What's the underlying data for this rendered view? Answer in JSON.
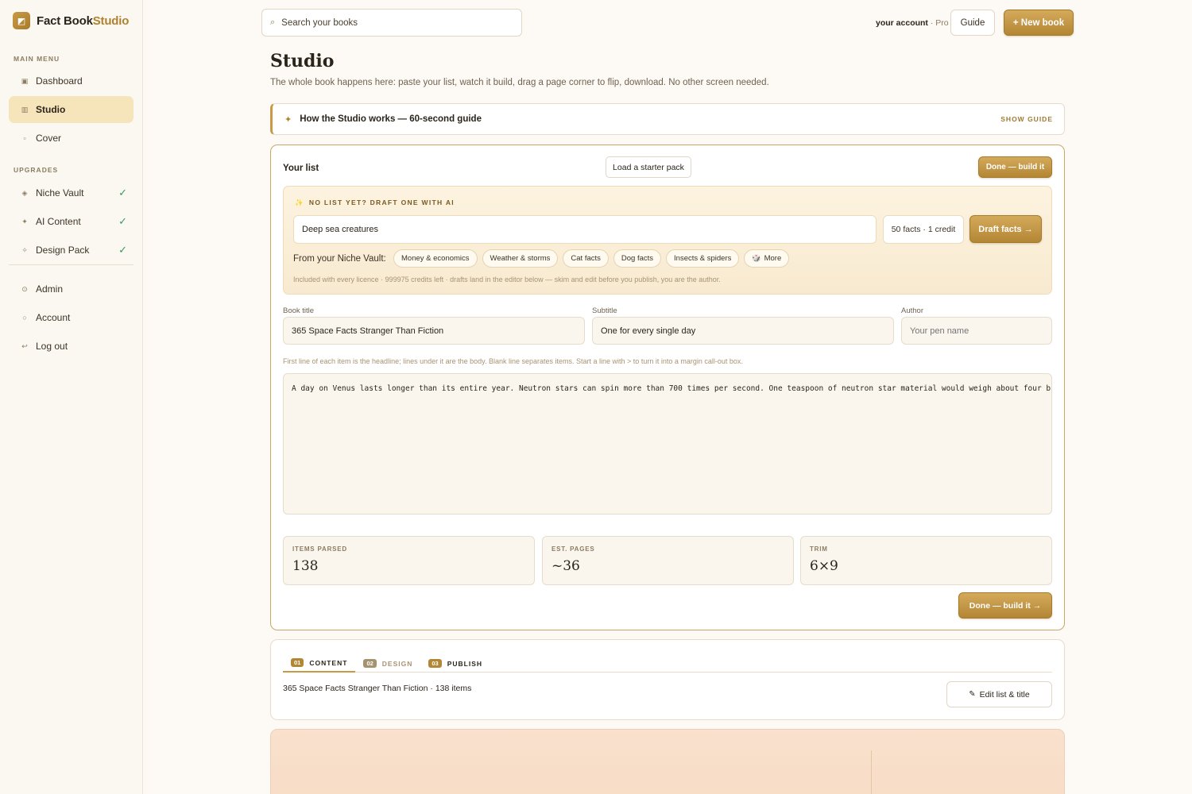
{
  "brand": {
    "name_main": "Fact Book",
    "name_accent": "Studio"
  },
  "sidebar": {
    "main_menu_label": "MAIN MENU",
    "main_items": [
      {
        "label": "Dashboard",
        "icon": "dashboard-icon"
      },
      {
        "label": "Studio",
        "icon": "studio-icon",
        "active": true
      },
      {
        "label": "Cover",
        "icon": "cover-icon"
      }
    ],
    "upgrades_label": "UPGRADES",
    "upgrade_items": [
      {
        "label": "Niche Vault",
        "icon": "vault-icon",
        "check": "✓"
      },
      {
        "label": "AI Content",
        "icon": "sparkle-icon",
        "check": "✓"
      },
      {
        "label": "Design Pack",
        "icon": "design-icon",
        "check": "✓"
      }
    ],
    "other_items": [
      {
        "label": "Admin",
        "icon": "admin-icon"
      },
      {
        "label": "Account",
        "icon": "account-icon"
      },
      {
        "label": "Log out",
        "icon": "logout-icon"
      }
    ]
  },
  "topbar": {
    "search_placeholder": "Search your books",
    "account_label": "your account",
    "account_tier": " · Pro",
    "guide_label": "Guide",
    "new_book_label": "+ New book"
  },
  "header": {
    "title": "Studio",
    "subtitle": "The whole book happens here: paste your list, watch it build, drag a page corner to flip, download. No other screen needed."
  },
  "guide_banner": {
    "title": "How the Studio works — 60-second guide",
    "action": "SHOW GUIDE"
  },
  "list_card": {
    "title": "Your list",
    "starter_label": "Load a starter pack",
    "done_top_label": "Done — build it",
    "ai": {
      "heading": "NO LIST YET? DRAFT ONE WITH AI",
      "topic_value": "Deep sea creatures",
      "count_label": "50 facts · 1 credit",
      "draft_label": "Draft facts →",
      "vault_label": "From your Niche Vault:",
      "chips": [
        "Money & economics",
        "Weather & storms",
        "Cat facts",
        "Dog facts",
        "Insects & spiders"
      ],
      "more_label": "More",
      "note": "Included with every licence · 999975 credits left · drafts land in the editor below — skim and edit before you publish, you are the author."
    },
    "fields": {
      "title_label": "Book title",
      "title_value": "365 Space Facts Stranger Than Fiction",
      "subtitle_label": "Subtitle",
      "subtitle_value": "One for every single day",
      "author_label": "Author",
      "author_placeholder": "Your pen name"
    },
    "help_line": "First line of each item is the headline; lines under it are the body. Blank line separates items. Start a line with > to turn it into a margin call-out box.",
    "list_text": "A day on Venus lasts longer than its entire year. Neutron stars can spin more than 700 times per second. One teaspoon of neutron star material would weigh about four billion tons.",
    "stats": [
      {
        "label": "ITEMS PARSED",
        "value": "138"
      },
      {
        "label": "EST. PAGES",
        "value": "~36"
      },
      {
        "label": "TRIM",
        "value": "6×9"
      }
    ],
    "done_bottom_label": "Done — build it →"
  },
  "steps": {
    "tabs": [
      {
        "num": "01",
        "label": "CONTENT"
      },
      {
        "num": "02",
        "label": "DESIGN"
      },
      {
        "num": "03",
        "label": "PUBLISH"
      }
    ],
    "summary": "365 Space Facts Stranger Than Fiction · 138 items",
    "edit_label": "Edit list & title"
  },
  "colors": {
    "accent": "#c99a45",
    "accent_dark": "#b38634",
    "check": "#3a9a5c"
  }
}
